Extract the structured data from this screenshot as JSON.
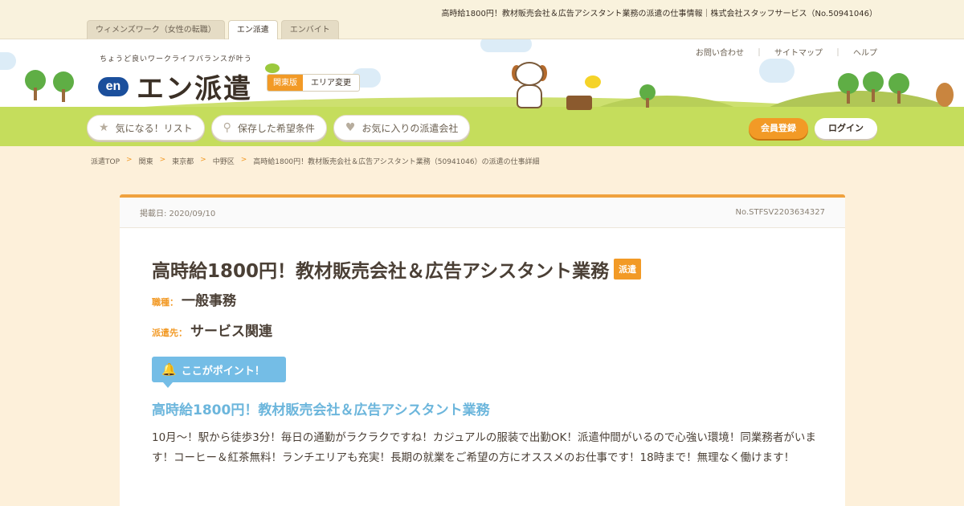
{
  "topbar": {
    "page_title": "高時給1800円！教材販売会社＆広告アシスタント業務の派遣の仕事情報｜株式会社スタッフサービス（No.50941046）",
    "tabs": [
      {
        "label": "ウィメンズワーク（女性の転職）",
        "active": false
      },
      {
        "label": "エン派遣",
        "active": true
      },
      {
        "label": "エンバイト",
        "active": false
      }
    ]
  },
  "header": {
    "tagline": "ちょうど良いワークライフバランスが叶う",
    "logo_en": "en",
    "logo_text": "エン派遣",
    "region_current": "関東版",
    "region_change": "エリア変更",
    "util_links": [
      "お問い合わせ",
      "サイトマップ",
      "ヘルプ"
    ],
    "util_separator": "｜",
    "nav": [
      {
        "label": "気になる！リスト",
        "icon": "star-icon"
      },
      {
        "label": "保存した希望条件",
        "icon": "search-icon"
      },
      {
        "label": "お気に入りの派遣会社",
        "icon": "heart-icon"
      }
    ],
    "register_label": "会員登録",
    "login_label": "ログイン"
  },
  "breadcrumb": {
    "items": [
      "派遣TOP",
      "関東",
      "東京都",
      "中野区",
      "高時給1800円！教材販売会社＆広告アシスタント業務（50941046）の派遣の仕事詳細"
    ],
    "separator": ">"
  },
  "job": {
    "posted": "掲載日: 2020/09/10",
    "number": "No.STFSV2203634327",
    "title": "高時給1800円！教材販売会社＆広告アシスタント業務",
    "tag": "派遣",
    "category_label": "職種：",
    "category_value": "一般事務",
    "dest_label": "派遣先：",
    "dest_value": "サービス関連",
    "point_badge": "ここがポイント！",
    "point_title": "高時給1800円！教材販売会社＆広告アシスタント業務",
    "point_desc": "10月～！駅から徒歩3分！毎日の通勤がラクラクですね！カジュアルの服装で出勤OK！派遣仲間がいるので心強い環境！同業務者がいます！コーヒー＆紅茶無料！ランチエリアも充実！長期の就業をご希望の方にオススメのお仕事です！18時まで！無理なく働けます！"
  },
  "colors": {
    "accent": "#f29a26",
    "point_blue": "#74bde6",
    "page_bg": "#fdf0da",
    "grass": "#c5dd5c"
  }
}
